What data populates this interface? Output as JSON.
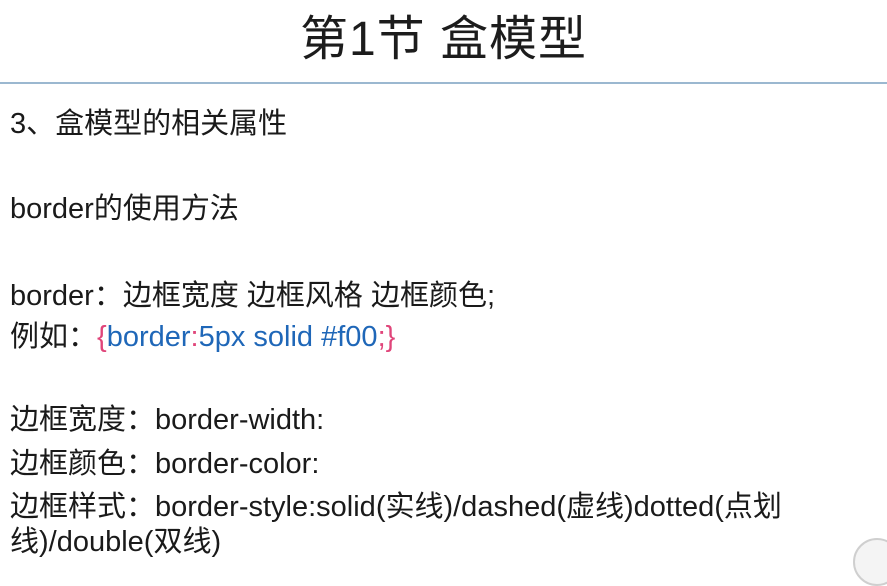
{
  "slide": {
    "title": "第1节 盒模型",
    "heading": "3、盒模型的相关属性",
    "usage": "border的使用方法",
    "syntax": "border：边框宽度 边框风格 边框颜色;",
    "example": {
      "label": "例如：",
      "open_brace": "{",
      "prop": "border",
      "colon": ":",
      "value": "5px solid #f00",
      "semicolon_brace": ";}"
    },
    "width_line": "边框宽度：border-width:",
    "color_line": "边框颜色：border-color:",
    "style_line": "边框样式：border-style:solid(实线)/dashed(虚线)dotted(点划线)/double(双线)"
  },
  "colors": {
    "rule": "#9bb8d0",
    "code_blue": "#1f67b8",
    "brace_pink": "#e0457a"
  }
}
